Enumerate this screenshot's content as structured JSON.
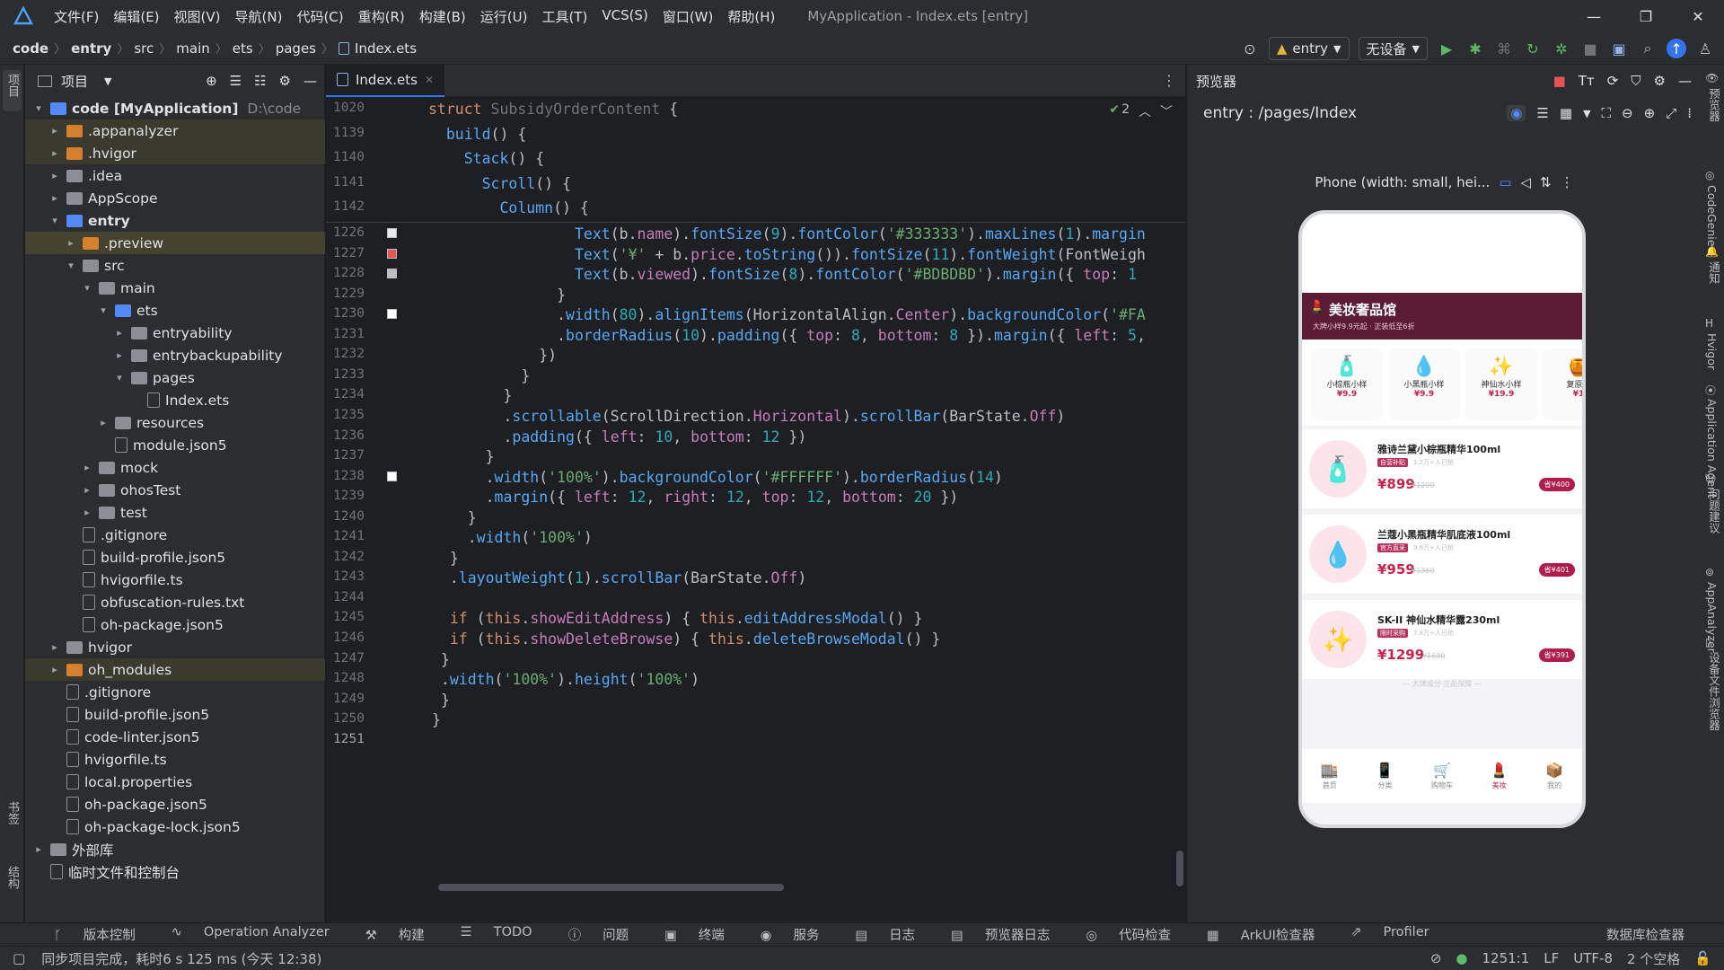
{
  "app": {
    "title": "MyApplication - Index.ets [entry]",
    "menu": [
      "文件(F)",
      "编辑(E)",
      "视图(V)",
      "导航(N)",
      "代码(C)",
      "重构(R)",
      "构建(B)",
      "运行(U)",
      "工具(T)",
      "VCS(S)",
      "窗口(W)",
      "帮助(H)"
    ]
  },
  "breadcrumb": [
    "code",
    "entry",
    "src",
    "main",
    "ets",
    "pages",
    "Index.ets"
  ],
  "toolbar": {
    "module": "entry",
    "device": "无设备"
  },
  "left_strip": {
    "top": "项目",
    "bottom1": "书签",
    "bottom2": "结构"
  },
  "project": {
    "header": "项目",
    "tree": [
      {
        "label": "code [MyApplication]",
        "path": "D:\\code",
        "depth": 0,
        "arrow": "▾",
        "icon": "folder blue",
        "bold": true
      },
      {
        "label": ".appanalyzer",
        "depth": 1,
        "arrow": "▸",
        "icon": "folder orange",
        "hl": "hl"
      },
      {
        "label": ".hvigor",
        "depth": 1,
        "arrow": "▸",
        "icon": "folder orange",
        "hl": "hl"
      },
      {
        "label": ".idea",
        "depth": 1,
        "arrow": "▸",
        "icon": "folder"
      },
      {
        "label": "AppScope",
        "depth": 1,
        "arrow": "▸",
        "icon": "folder"
      },
      {
        "label": "entry",
        "depth": 1,
        "arrow": "▾",
        "icon": "folder blue",
        "bold": true
      },
      {
        "label": ".preview",
        "depth": 2,
        "arrow": "▸",
        "icon": "folder orange",
        "hl": "hl2"
      },
      {
        "label": "src",
        "depth": 2,
        "arrow": "▾",
        "icon": "folder"
      },
      {
        "label": "main",
        "depth": 3,
        "arrow": "▾",
        "icon": "folder"
      },
      {
        "label": "ets",
        "depth": 4,
        "arrow": "▾",
        "icon": "folder blue"
      },
      {
        "label": "entryability",
        "depth": 5,
        "arrow": "▸",
        "icon": "folder"
      },
      {
        "label": "entrybackupability",
        "depth": 5,
        "arrow": "▸",
        "icon": "folder"
      },
      {
        "label": "pages",
        "depth": 5,
        "arrow": "▾",
        "icon": "folder"
      },
      {
        "label": "Index.ets",
        "depth": 6,
        "arrow": "",
        "icon": "file"
      },
      {
        "label": "resources",
        "depth": 4,
        "arrow": "▸",
        "icon": "folder"
      },
      {
        "label": "module.json5",
        "depth": 4,
        "arrow": "",
        "icon": "file"
      },
      {
        "label": "mock",
        "depth": 3,
        "arrow": "▸",
        "icon": "folder"
      },
      {
        "label": "ohosTest",
        "depth": 3,
        "arrow": "▸",
        "icon": "folder"
      },
      {
        "label": "test",
        "depth": 3,
        "arrow": "▸",
        "icon": "folder"
      },
      {
        "label": ".gitignore",
        "depth": 2,
        "arrow": "",
        "icon": "file"
      },
      {
        "label": "build-profile.json5",
        "depth": 2,
        "arrow": "",
        "icon": "file"
      },
      {
        "label": "hvigorfile.ts",
        "depth": 2,
        "arrow": "",
        "icon": "file"
      },
      {
        "label": "obfuscation-rules.txt",
        "depth": 2,
        "arrow": "",
        "icon": "file"
      },
      {
        "label": "oh-package.json5",
        "depth": 2,
        "arrow": "",
        "icon": "file"
      },
      {
        "label": "hvigor",
        "depth": 1,
        "arrow": "▸",
        "icon": "folder"
      },
      {
        "label": "oh_modules",
        "depth": 1,
        "arrow": "▸",
        "icon": "folder orange",
        "hl": "hl"
      },
      {
        "label": ".gitignore",
        "depth": 1,
        "arrow": "",
        "icon": "file"
      },
      {
        "label": "build-profile.json5",
        "depth": 1,
        "arrow": "",
        "icon": "file"
      },
      {
        "label": "code-linter.json5",
        "depth": 1,
        "arrow": "",
        "icon": "file"
      },
      {
        "label": "hvigorfile.ts",
        "depth": 1,
        "arrow": "",
        "icon": "file"
      },
      {
        "label": "local.properties",
        "depth": 1,
        "arrow": "",
        "icon": "file"
      },
      {
        "label": "oh-package.json5",
        "depth": 1,
        "arrow": "",
        "icon": "file"
      },
      {
        "label": "oh-package-lock.json5",
        "depth": 1,
        "arrow": "",
        "icon": "file"
      },
      {
        "label": "外部库",
        "depth": 0,
        "arrow": "▸",
        "icon": "folder"
      },
      {
        "label": "临时文件和控制台",
        "depth": 0,
        "arrow": "",
        "icon": "file"
      }
    ]
  },
  "editor": {
    "tab": "Index.ets",
    "inspection_count": "2",
    "sticky_lines": [
      {
        "num": "1020",
        "html": "<span class=\"kw\">struct</span> <span style=\"color:#6f737a\">SubsidyOrderContent</span> <span class=\"pl\">{</span>"
      },
      {
        "num": "1139",
        "html": "  <span class=\"fn\">build</span><span class=\"pl\">() {</span>"
      },
      {
        "num": "1140",
        "html": "    <span class=\"fn\">Stack</span><span class=\"pl\">() {</span>"
      },
      {
        "num": "1141",
        "html": "      <span class=\"fn\">Scroll</span><span class=\"pl\">() {</span>"
      },
      {
        "num": "1142",
        "html": "        <span class=\"fn\">Column</span><span class=\"pl\">() {</span>"
      }
    ],
    "lines": [
      {
        "num": "1226",
        "html": "                <span class=\"fn\">Text</span>(b.<span class=\"pr\">name</span>).<span class=\"fn\">fontSize</span>(<span class=\"nm\">9</span>).<span class=\"fn\">fontColor</span>(<span class=\"st\">'#333333'</span>).<span class=\"fn\">maxLines</span>(<span class=\"nm\">1</span>).<span class=\"fn\">margin</span>"
      },
      {
        "num": "1227",
        "html": "                <span class=\"fn\">Text</span>(<span class=\"st\">'¥'</span> + b.<span class=\"pr\">price</span>.<span class=\"fn\">toString</span>()).<span class=\"fn\">fontSize</span>(<span class=\"nm\">11</span>).<span class=\"fn\">fontWeight</span>(FontWeigh"
      },
      {
        "num": "1228",
        "html": "                <span class=\"fn\">Text</span>(b.<span class=\"pr\">viewed</span>).<span class=\"fn\">fontSize</span>(<span class=\"nm\">8</span>).<span class=\"fn\">fontColor</span>(<span class=\"st\">'#BDBDBD'</span>).<span class=\"fn\">margin</span>({ <span class=\"pr\">top</span>: <span class=\"nm\">1</span>"
      },
      {
        "num": "1229",
        "html": "              }"
      },
      {
        "num": "1230",
        "html": "              .<span class=\"fn\">width</span>(<span class=\"nm\">80</span>).<span class=\"fn\">alignItems</span>(HorizontalAlign.<span class=\"pr\">Center</span>).<span class=\"fn\">backgroundColor</span>(<span class=\"st\">'#FA</span>"
      },
      {
        "num": "1231",
        "html": "              .<span class=\"fn\">borderRadius</span>(<span class=\"nm\">10</span>).<span class=\"fn\">padding</span>({ <span class=\"pr\">top</span>: <span class=\"nm\">8</span>, <span class=\"pr\">bottom</span>: <span class=\"nm\">8</span> }).<span class=\"fn\">margin</span>({ <span class=\"pr\">left</span>: <span class=\"nm\">5</span>,"
      },
      {
        "num": "1232",
        "html": "            })"
      },
      {
        "num": "1233",
        "html": "          }"
      },
      {
        "num": "1234",
        "html": "        }"
      },
      {
        "num": "1235",
        "html": "        .<span class=\"fn\">scrollable</span>(ScrollDirection.<span class=\"pr\">Horizontal</span>).<span class=\"fn\">scrollBar</span>(BarState.<span class=\"pr\">Off</span>)"
      },
      {
        "num": "1236",
        "html": "        .<span class=\"fn\">padding</span>({ <span class=\"pr\">left</span>: <span class=\"nm\">10</span>, <span class=\"pr\">bottom</span>: <span class=\"nm\">12</span> })"
      },
      {
        "num": "1237",
        "html": "      }"
      },
      {
        "num": "1238",
        "html": "      .<span class=\"fn\">width</span>(<span class=\"st\">'100%'</span>).<span class=\"fn\">backgroundColor</span>(<span class=\"st\">'#FFFFFF'</span>).<span class=\"fn\">borderRadius</span>(<span class=\"nm\">14</span>)"
      },
      {
        "num": "1239",
        "html": "      .<span class=\"fn\">margin</span>({ <span class=\"pr\">left</span>: <span class=\"nm\">12</span>, <span class=\"pr\">right</span>: <span class=\"nm\">12</span>, <span class=\"pr\">top</span>: <span class=\"nm\">12</span>, <span class=\"pr\">bottom</span>: <span class=\"nm\">20</span> })"
      },
      {
        "num": "1240",
        "html": "    }"
      },
      {
        "num": "1241",
        "html": "    .<span class=\"fn\">width</span>(<span class=\"st\">'100%'</span>)"
      },
      {
        "num": "1242",
        "html": "  }"
      },
      {
        "num": "1243",
        "html": "  .<span class=\"fn\">layoutWeight</span>(<span class=\"nm\">1</span>).<span class=\"fn\">scrollBar</span>(BarState.<span class=\"pr\">Off</span>)"
      },
      {
        "num": "1244",
        "html": ""
      },
      {
        "num": "1245",
        "html": "  <span class=\"kw\">if</span> (<span class=\"kw\">this</span>.<span class=\"pr\">showEditAddress</span>) { <span class=\"kw\">this</span>.<span class=\"fn\">editAddressModal</span>() }"
      },
      {
        "num": "1246",
        "html": "  <span class=\"kw\">if</span> (<span class=\"kw\">this</span>.<span class=\"pr\">showDeleteBrowse</span>) { <span class=\"kw\">this</span>.<span class=\"fn\">deleteBrowseModal</span>() }"
      },
      {
        "num": "1247",
        "html": " }"
      },
      {
        "num": "1248",
        "html": " .<span class=\"fn\">width</span>(<span class=\"st\">'100%'</span>).<span class=\"fn\">height</span>(<span class=\"st\">'100%'</span>)"
      },
      {
        "num": "1249",
        "html": " }"
      },
      {
        "num": "1250",
        "html": "}"
      },
      {
        "num": "1251",
        "html": ""
      }
    ]
  },
  "preview": {
    "header": "预览器",
    "route": "entry : /pages/Index",
    "device_label": "Phone (width: small, hei...",
    "phone": {
      "shop_title": "美妆奢品馆",
      "shop_sub": "大牌小样9.9元起 · 正装低至6折",
      "categories": [
        {
          "name": "小棕瓶小样",
          "price": "¥9.9"
        },
        {
          "name": "小黑瓶小样",
          "price": "¥9.9"
        },
        {
          "name": "神仙水小样",
          "price": "¥19.9"
        },
        {
          "name": "复原蜜",
          "price": "¥1"
        }
      ],
      "products": [
        {
          "name": "雅诗兰黛小棕瓶精华100ml",
          "tag": "自营补贴",
          "viewed": "1.2万+人已抢",
          "price": "¥899",
          "old": "¥1299",
          "btn": "省¥400",
          "emoji": "🧴"
        },
        {
          "name": "兰蔻小黑瓶精华肌底液100ml",
          "tag": "官方直采",
          "viewed": "9.6万+人已抢",
          "price": "¥959",
          "old": "¥1360",
          "btn": "省¥401",
          "emoji": "💧"
        },
        {
          "name": "SK-II 神仙水精华露230ml",
          "tag": "限时采购",
          "viewed": "7.8万+人已抢",
          "price": "¥1299",
          "old": "¥1690",
          "btn": "省¥391",
          "emoji": "✨"
        }
      ],
      "footer": "— 大牌成分·正品保障 —",
      "nav": [
        "首页",
        "分类",
        "购物车",
        "美妆",
        "我的"
      ]
    }
  },
  "right_strip": [
    "预览器",
    "CodeGenie",
    "通知",
    "Hvigor",
    "Application Agent",
    "问题建议",
    "AppAnalyzer",
    "设备文件浏览器"
  ],
  "bottom_tools": [
    "版本控制",
    "Operation Analyzer",
    "构建",
    "TODO",
    "问题",
    "终端",
    "服务",
    "日志",
    "预览器日志",
    "代码检查",
    "ArkUI检查器",
    "Profiler"
  ],
  "bottom_tools_right": "数据库检查器",
  "status": {
    "message": "同步项目完成，耗时6 s 125 ms (今天 12:38)",
    "position": "1251:1",
    "line_sep": "LF",
    "encoding": "UTF-8",
    "indent": "2 个空格"
  }
}
